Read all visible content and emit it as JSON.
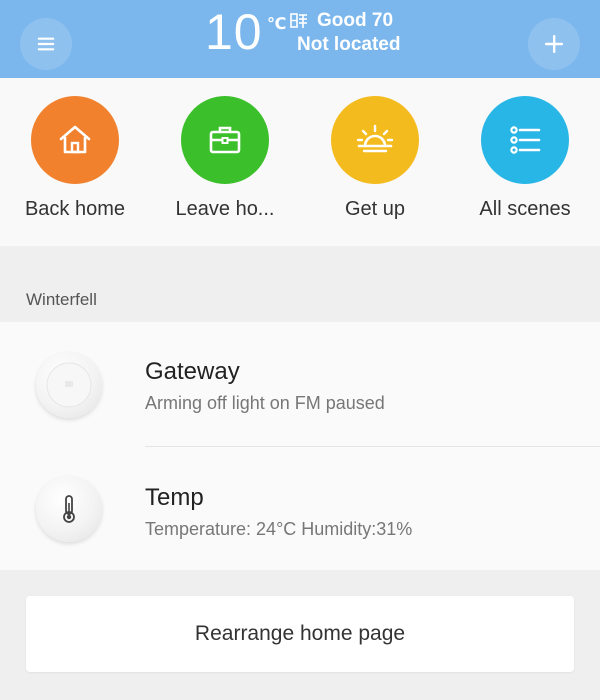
{
  "header": {
    "temperature": "10",
    "unit": "℃",
    "condition_icon": "weather-condition-icon",
    "air_quality": "Good 70",
    "location": "Not located",
    "bg_color": "#7bb7ec"
  },
  "scenes": [
    {
      "label": "Back home",
      "icon": "home-icon",
      "color": "#f1812c"
    },
    {
      "label": "Leave ho...",
      "icon": "briefcase-icon",
      "color": "#3bbf2a"
    },
    {
      "label": "Get up",
      "icon": "sunrise-icon",
      "color": "#f4bb1e"
    },
    {
      "label": "All scenes",
      "icon": "list-icon",
      "color": "#27b6e6"
    }
  ],
  "section": {
    "title": "Winterfell"
  },
  "devices": [
    {
      "name": "Gateway",
      "status": "Arming off light on FM paused",
      "icon": "gateway-device-icon"
    },
    {
      "name": "Temp",
      "status": "Temperature: 24°C Humidity:31%",
      "icon": "thermometer-icon"
    }
  ],
  "footer": {
    "rearrange_label": "Rearrange home page"
  }
}
